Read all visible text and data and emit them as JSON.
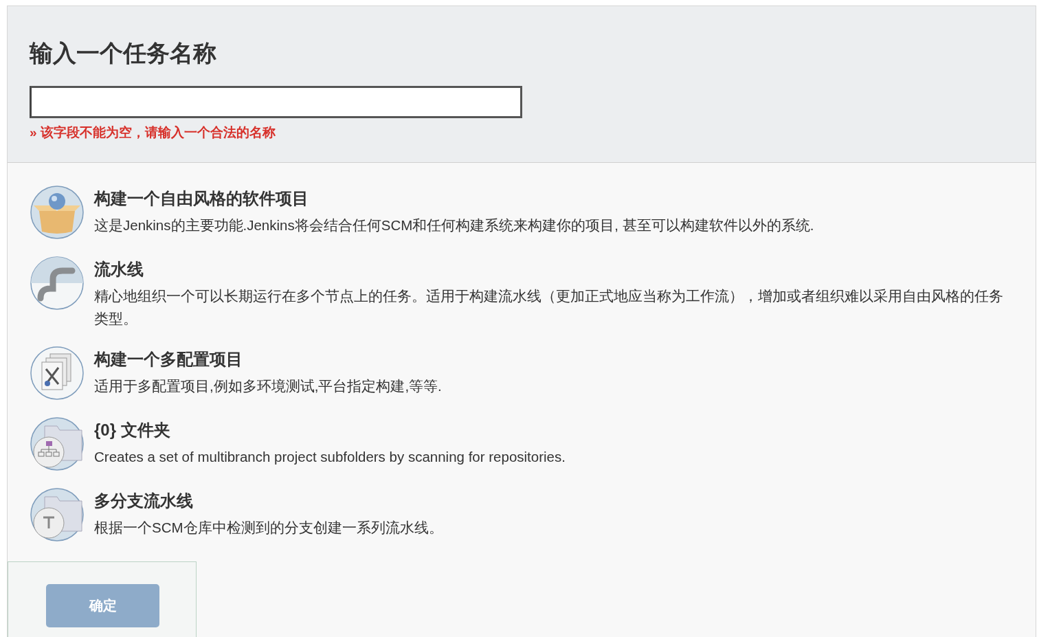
{
  "header": {
    "title": "输入一个任务名称",
    "error": "» 该字段不能为空，请输入一个合法的名称"
  },
  "items": [
    {
      "kind": "freestyle",
      "title": "构建一个自由风格的软件项目",
      "description": "这是Jenkins的主要功能.Jenkins将会结合任何SCM和任何构建系统来构建你的项目, 甚至可以构建软件以外的系统."
    },
    {
      "kind": "pipeline",
      "title": "流水线",
      "description": "精心地组织一个可以长期运行在多个节点上的任务。适用于构建流水线（更加正式地应当称为工作流），增加或者组织难以采用自由风格的任务类型。"
    },
    {
      "kind": "matrix",
      "title": "构建一个多配置项目",
      "description": "适用于多配置项目,例如多环境测试,平台指定构建,等等."
    },
    {
      "kind": "orgfolder",
      "title": "{0} 文件夹",
      "description": "Creates a set of multibranch project subfolders by scanning for repositories."
    },
    {
      "kind": "multibranch",
      "title": "多分支流水线",
      "description": "根据一个SCM仓库中检测到的分支创建一系列流水线。"
    }
  ],
  "footer": {
    "ok_button": "确定"
  }
}
